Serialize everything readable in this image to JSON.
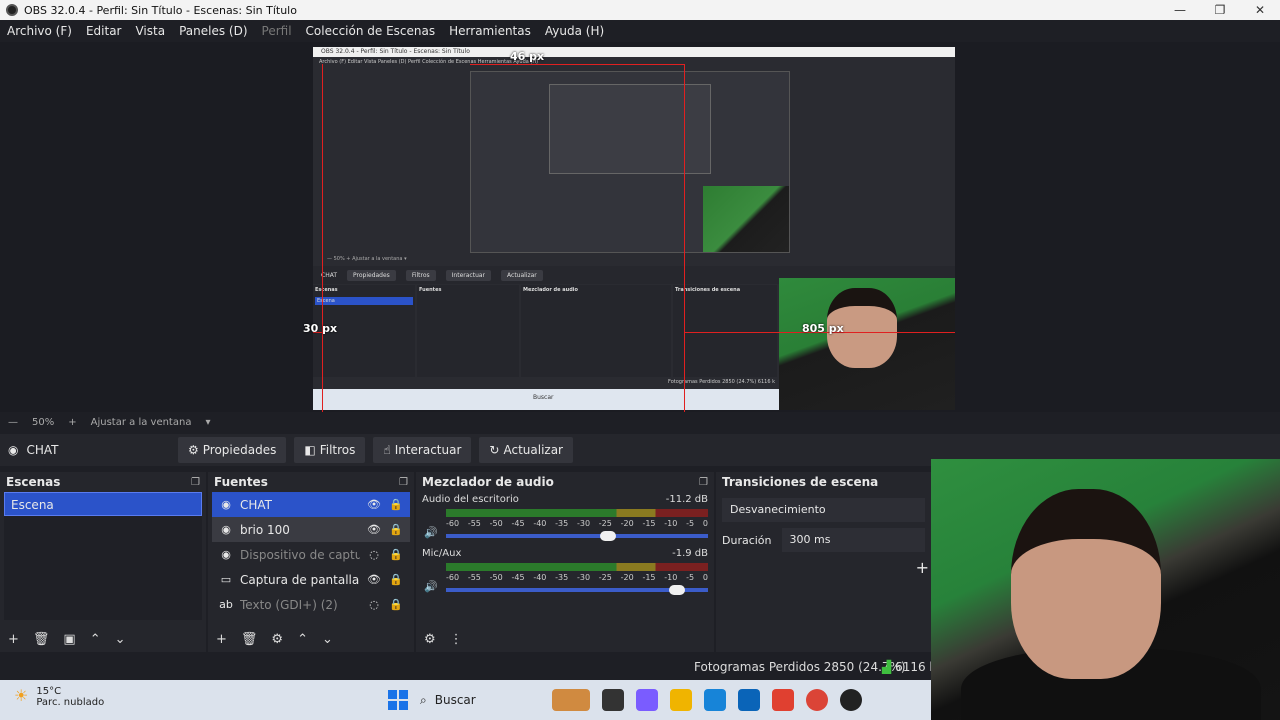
{
  "window": {
    "title": "OBS 32.0.4 - Perfil: Sin Título - Escenas: Sin Título",
    "minimize": "—",
    "maximize": "❐",
    "close": "✕"
  },
  "menu": [
    "Archivo (F)",
    "Editar",
    "Vista",
    "Paneles (D)",
    "Perfil",
    "Colección de Escenas",
    "Herramientas",
    "Ayuda (H)"
  ],
  "preview": {
    "guide_top": "46 px",
    "guide_left": "30 px",
    "guide_right": "805 px",
    "nested_title": "OBS 32.0.4 - Perfil: Sin Título - Escenas: Sin Título",
    "nested_menu": "Archivo (F)   Editar   Vista   Paneles (D)   Perfil   Colección de Escenas   Herramientas   Ayuda (H)",
    "nested_zoom": "—  50%  +  Ajustar a la ventana  ▾",
    "nested_chat": "CHAT",
    "nested_btns": [
      "Propiedades",
      "Filtros",
      "Interactuar",
      "Actualizar"
    ],
    "nested_docks": [
      "Escenas",
      "Fuentes",
      "Mezclador de audio",
      "Transiciones de escena"
    ],
    "nested_scene": "Escena",
    "nested_status": "Fotogramas Perdidos 2850 (24.7%)   6116 k",
    "nested_search": "Buscar"
  },
  "zoom": {
    "minus": "—",
    "value": "50%",
    "plus": "+",
    "fit": "Ajustar a la ventana",
    "arrow": "▾"
  },
  "context": {
    "source": "CHAT",
    "buttons": [
      {
        "icon": "⚙",
        "label": "Propiedades"
      },
      {
        "icon": "◧",
        "label": "Filtros"
      },
      {
        "icon": "☝",
        "label": "Interactuar"
      },
      {
        "icon": "↻",
        "label": "Actualizar"
      }
    ]
  },
  "scenes": {
    "title": "Escenas",
    "items": [
      "Escena"
    ],
    "footer": [
      "+",
      "🗑",
      "▣",
      "⌃",
      "⌄"
    ]
  },
  "sources": {
    "title": "Fuentes",
    "items": [
      {
        "icon": "◉",
        "name": "CHAT",
        "eye": "👁",
        "lock": "🔒",
        "state": "sel"
      },
      {
        "icon": "◉",
        "name": "brio 100",
        "eye": "👁",
        "lock": "🔒",
        "state": "hl"
      },
      {
        "icon": "◉",
        "name": "Dispositivo de captura de vídeo",
        "eye": "◌",
        "lock": "🔒",
        "state": "dim"
      },
      {
        "icon": "▭",
        "name": "Captura de pantalla",
        "eye": "👁",
        "lock": "🔒",
        "state": ""
      },
      {
        "icon": "ab",
        "name": "Texto (GDI+) (2)",
        "eye": "◌",
        "lock": "🔒",
        "state": "dim"
      }
    ],
    "footer": [
      "+",
      "🗑",
      "⚙",
      "⌃",
      "⌄"
    ]
  },
  "mixer": {
    "title": "Mezclador de audio",
    "channels": [
      {
        "name": "Audio del escritorio",
        "db": "-11.2 dB",
        "level": 0.52,
        "volume": 0.62
      },
      {
        "name": "Mic/Aux",
        "db": "-1.9 dB",
        "level": 0.02,
        "volume": 0.88
      }
    ],
    "ticks": [
      "-60",
      "-55",
      "-50",
      "-45",
      "-40",
      "-35",
      "-30",
      "-25",
      "-20",
      "-15",
      "-10",
      "-5",
      "0"
    ],
    "footer": [
      "⚙",
      "⋮"
    ]
  },
  "transitions": {
    "title": "Transiciones de escena",
    "type": "Desvanecimiento",
    "duration_label": "Duración",
    "duration": "300 ms",
    "add": "+"
  },
  "status": {
    "frames": "Fotogramas Perdidos 2850 (24.7%)",
    "kb": "6116 k"
  },
  "taskbar": {
    "temp": "15°C",
    "weather": "Parc. nublado",
    "search": "Buscar"
  },
  "colors": {
    "accent": "#2b53c9",
    "guide": "#e02020",
    "bg": "#1e1f25",
    "dock": "#25262c"
  }
}
